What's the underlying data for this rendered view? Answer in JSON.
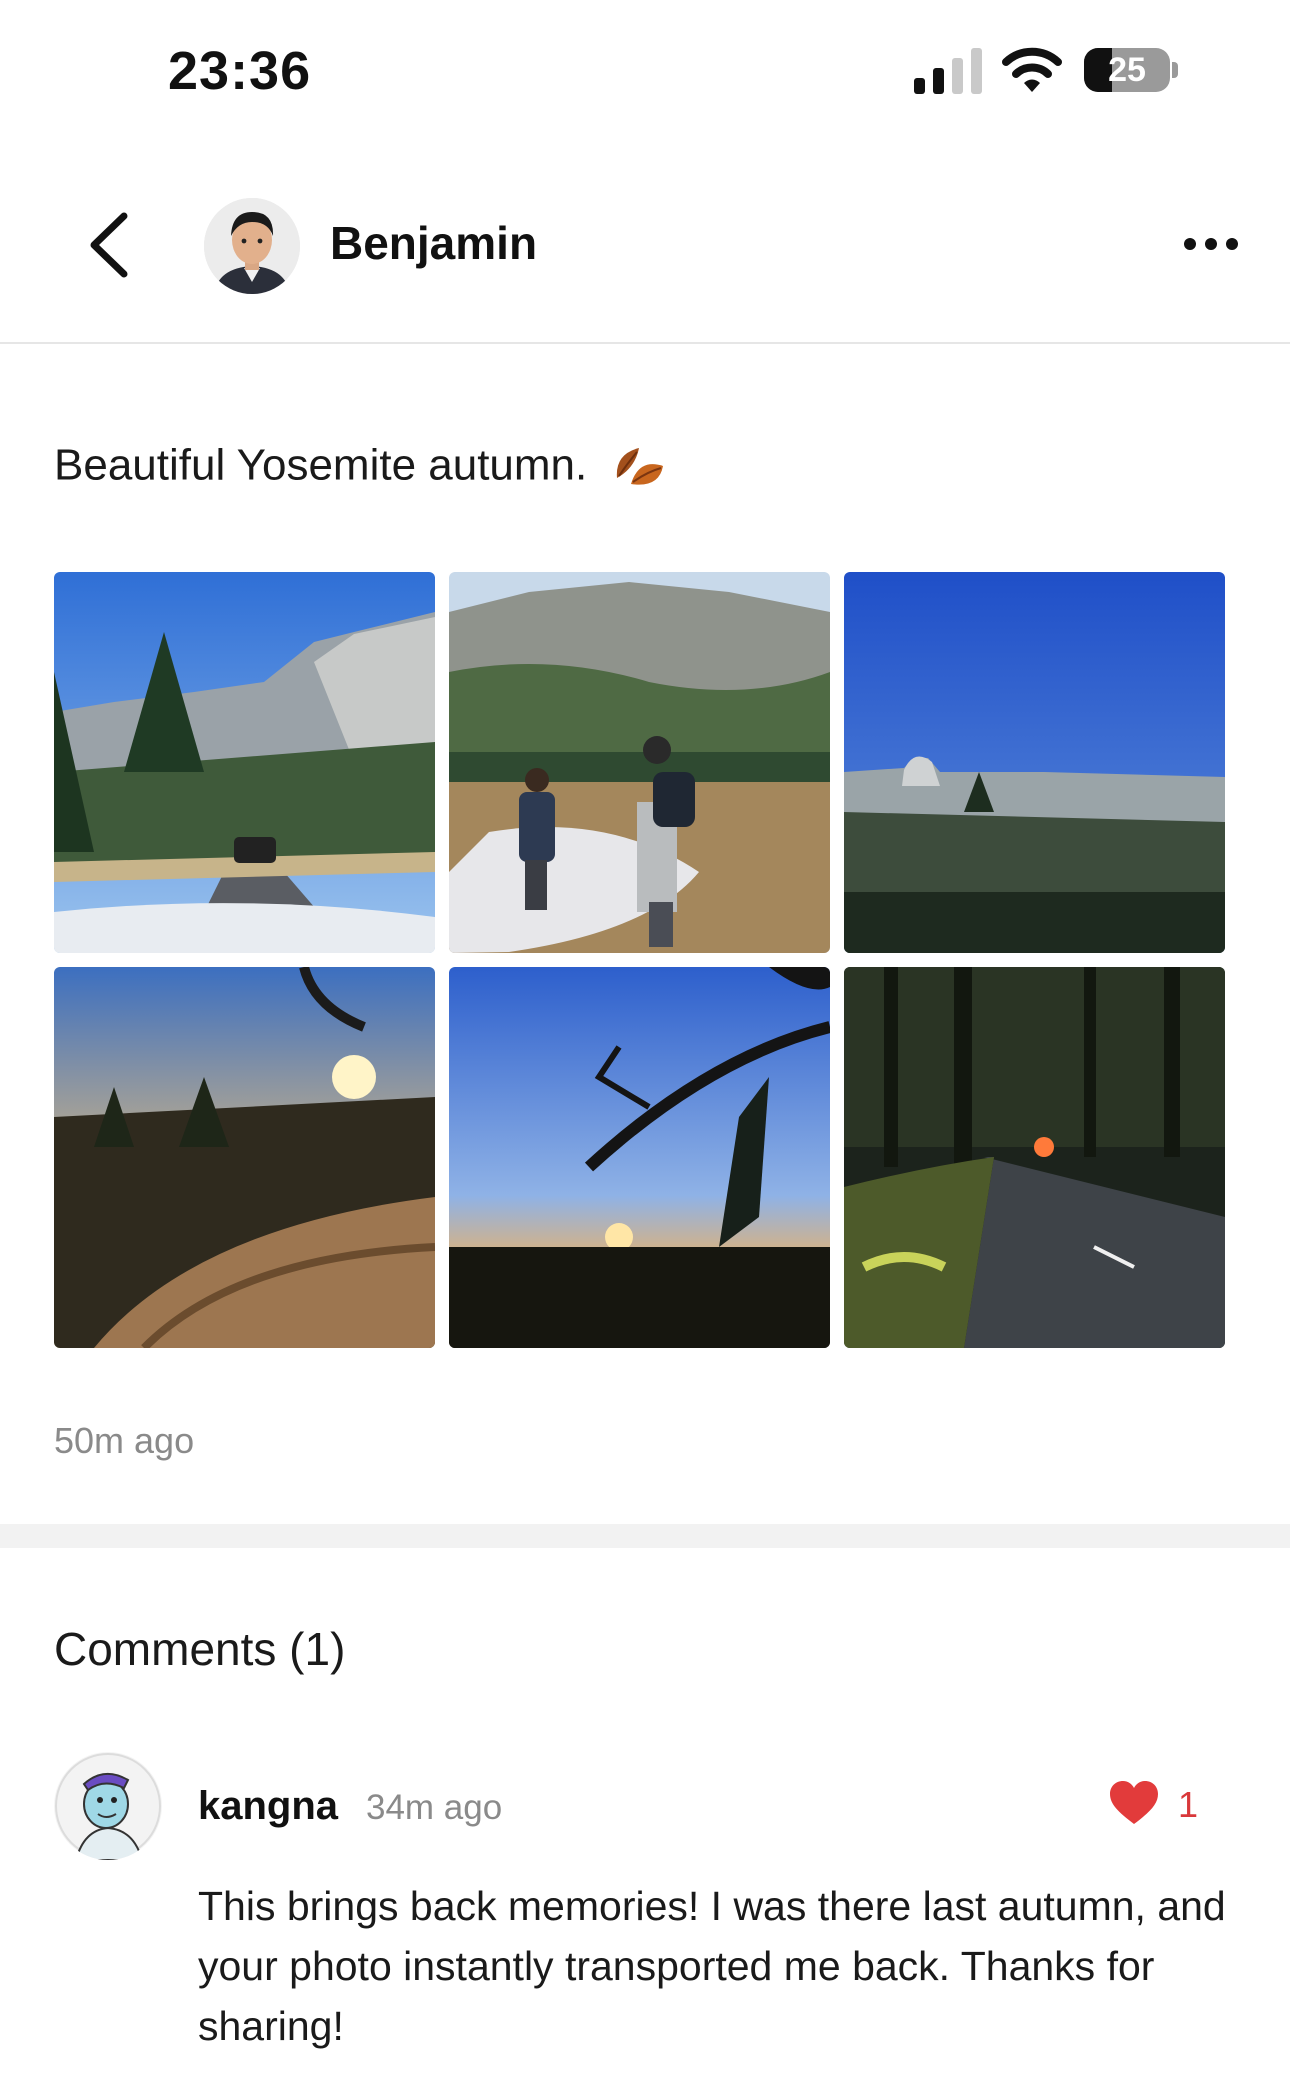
{
  "status_bar": {
    "time": "23:36",
    "battery_level": "25",
    "signal_bars": 2
  },
  "header": {
    "author_name": "Benjamin",
    "back_icon": "chevron-left-icon",
    "more_icon": "ellipsis-icon"
  },
  "post": {
    "caption": "Beautiful Yosemite autumn.",
    "caption_emoji": "fallen-leaf-icon",
    "time_ago": "50m ago",
    "photos": [
      "yosemite-valley-road",
      "hikers-meadow",
      "half-dome-view",
      "sunset-log",
      "sunset-branch",
      "forest-road-dusk"
    ]
  },
  "comments": {
    "title": "Comments (1)",
    "items": [
      {
        "user": "kangna",
        "time_ago": "34m ago",
        "likes": "1",
        "text": "This brings back memories! I was there last autumn, and your photo instantly transported me back. Thanks for sharing!"
      }
    ]
  },
  "colors": {
    "like": "#e23b3b",
    "muted_text": "#8a8a8a",
    "divider": "#f2f2f2"
  }
}
